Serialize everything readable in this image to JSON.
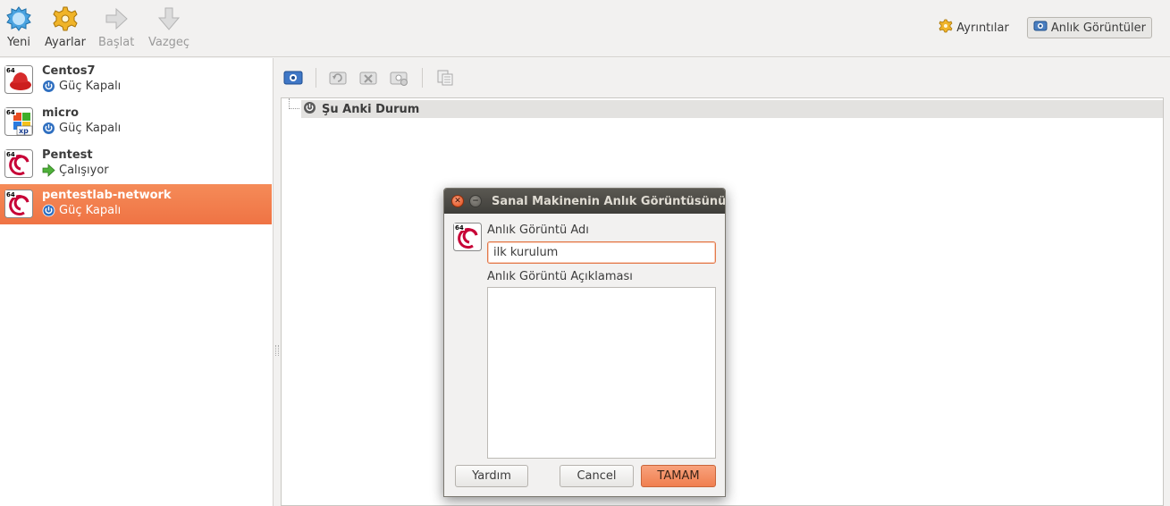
{
  "toolbar": {
    "new_label": "Yeni",
    "settings_label": "Ayarlar",
    "start_label": "Başlat",
    "discard_label": "Vazgeç",
    "details_label": "Ayrıntılar",
    "snapshots_label": "Anlık Görüntüler"
  },
  "vms": [
    {
      "name": "Centos7",
      "state": "Güç Kapalı",
      "os_icon": "redhat-64-icon",
      "arch": "64"
    },
    {
      "name": "micro",
      "state": "Güç Kapalı",
      "os_icon": "windows-xp-64-icon",
      "arch": "64",
      "os_tag": "xp"
    },
    {
      "name": "Pentest",
      "state": "Çalışıyor",
      "os_icon": "debian-64-icon",
      "arch": "64"
    },
    {
      "name": "pentestlab-network",
      "state": "Güç Kapalı",
      "os_icon": "debian-64-icon",
      "arch": "64",
      "selected": true
    }
  ],
  "snapshot_tree": {
    "current_state_label": "Şu Anki Durum"
  },
  "dialog": {
    "title": "Sanal Makinenin Anlık Görüntüsünü Al",
    "icon_arch": "64",
    "name_label": "Anlık Görüntü Adı",
    "name_value": "ilk kurulum",
    "description_label": "Anlık Görüntü Açıklaması",
    "description_value": "",
    "help_label": "Yardım",
    "cancel_label": "Cancel",
    "ok_label": "TAMAM"
  },
  "colors": {
    "accent": "#ef7344",
    "selection": "#f58b58",
    "titlebar": "#4a4945"
  }
}
